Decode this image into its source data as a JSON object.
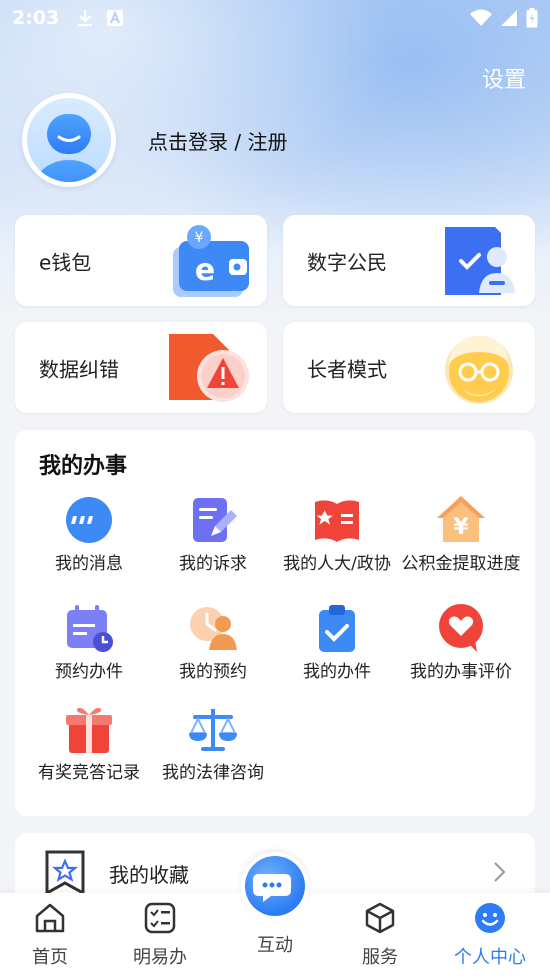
{
  "status_bar": {
    "time": "2:03"
  },
  "header": {
    "settings_label": "设置",
    "login_label": "点击登录 / 注册"
  },
  "quick_cards": [
    {
      "label": "e钱包",
      "icon": "e-wallet-icon"
    },
    {
      "label": "数字公民",
      "icon": "digital-citizen-icon"
    },
    {
      "label": "数据纠错",
      "icon": "data-error-icon"
    },
    {
      "label": "长者模式",
      "icon": "elder-mode-icon"
    }
  ],
  "my_affairs": {
    "title": "我的办事",
    "items": [
      {
        "label": "我的消息",
        "icon": "message-icon"
      },
      {
        "label": "我的诉求",
        "icon": "edit-appeal-icon"
      },
      {
        "label": "我的人大/政协",
        "icon": "book-icon"
      },
      {
        "label": "公积金提取进度",
        "icon": "house-fund-icon"
      },
      {
        "label": "预约办件",
        "icon": "calendar-clock-icon"
      },
      {
        "label": "我的预约",
        "icon": "appointment-person-icon"
      },
      {
        "label": "我的办件",
        "icon": "clipboard-check-icon"
      },
      {
        "label": "我的办事评价",
        "icon": "heart-chat-icon"
      },
      {
        "label": "有奖竞答记录",
        "icon": "gift-icon"
      },
      {
        "label": "我的法律咨询",
        "icon": "scale-icon"
      }
    ]
  },
  "favorites": {
    "label": "我的收藏",
    "icon": "bookmark-star-icon"
  },
  "tabbar": {
    "items": [
      {
        "label": "首页",
        "icon": "home-icon"
      },
      {
        "label": "明易办",
        "icon": "checklist-icon"
      },
      {
        "label": "互动",
        "icon": "chat-bubble-icon"
      },
      {
        "label": "服务",
        "icon": "cube-icon"
      },
      {
        "label": "个人中心",
        "icon": "smile-icon"
      }
    ],
    "active_index": 4
  },
  "colors": {
    "accent": "#2f7cf6"
  }
}
